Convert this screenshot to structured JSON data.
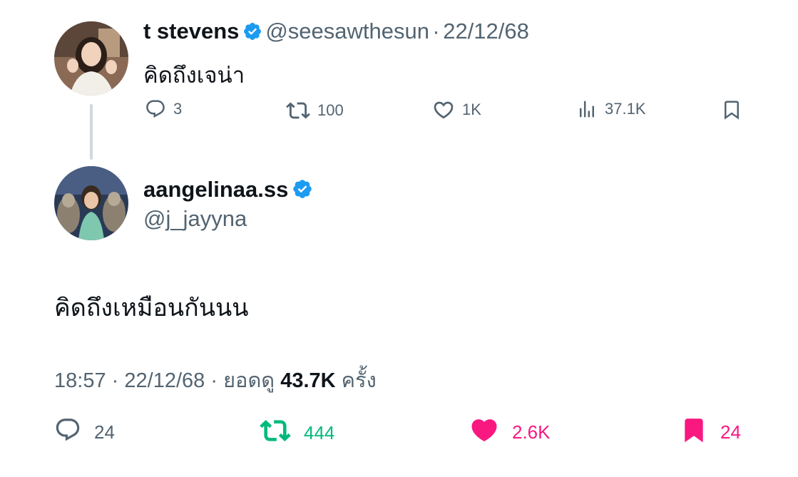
{
  "parent": {
    "display_name": "t stevens",
    "handle": "@seesawthesun",
    "separator": "·",
    "date": "22/12/68",
    "text": "คิดถึงเจน่า",
    "replies": "3",
    "retweets": "100",
    "likes": "1K",
    "views": "37.1K"
  },
  "reply": {
    "display_name": "aangelinaa.ss",
    "handle": "@j_jayyna",
    "text": "คิดถึงเหมือนกันนน",
    "time": "18:57",
    "separator": "·",
    "date": "22/12/68",
    "views_prefix": "ยอดดู",
    "views": "43.7K",
    "views_suffix": "ครั้ง",
    "replies": "24",
    "retweets": "444",
    "likes": "2.6K",
    "bookmarks": "24"
  },
  "colors": {
    "verified": "#1d9bf0",
    "retweet_active": "#00ba7c",
    "like_active": "#f91880",
    "bookmark_active": "#f91880",
    "muted": "#536471"
  },
  "icons": [
    "reply-icon",
    "retweet-icon",
    "like-icon",
    "views-icon",
    "bookmark-icon",
    "verified-badge-icon"
  ]
}
